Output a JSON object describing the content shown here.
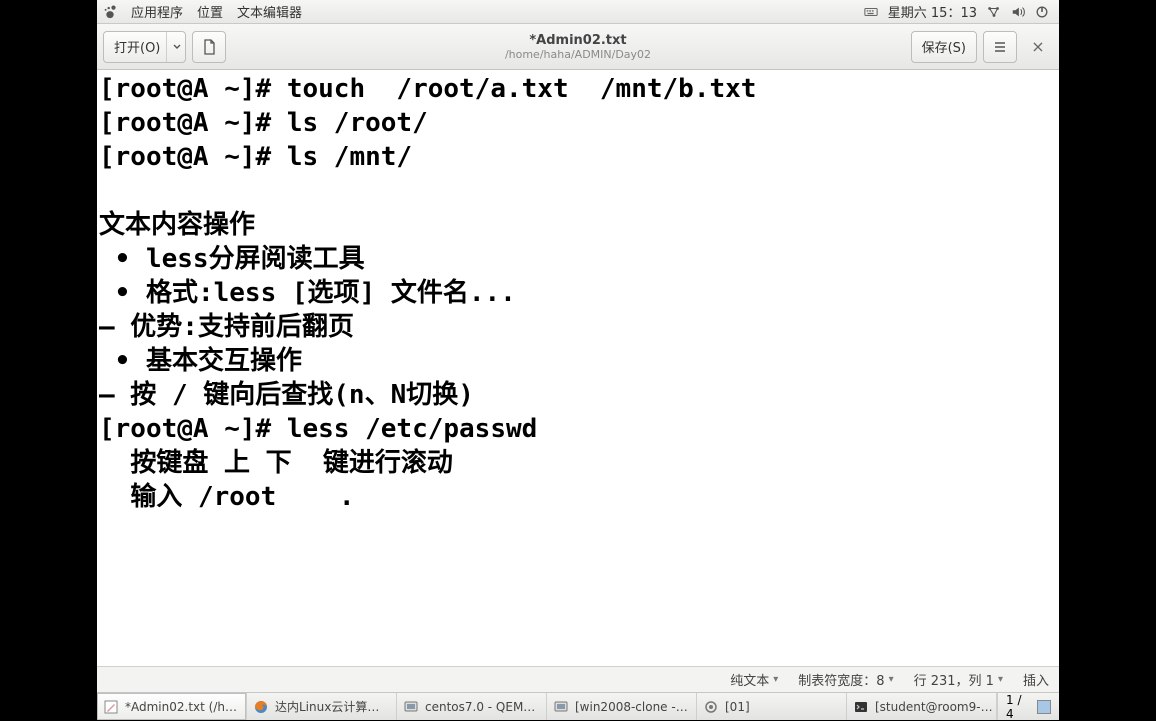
{
  "panel": {
    "menu_apps": "应用程序",
    "menu_places": "位置",
    "menu_editor": "文本编辑器",
    "clock": "星期六 15：13"
  },
  "editor": {
    "open_label": "打开(O)",
    "save_label": "保存(S)",
    "title": "*Admin02.txt",
    "subtitle": "/home/haha/ADMIN/Day02"
  },
  "document": {
    "lines": "[root@A ~]# touch  /root/a.txt  /mnt/b.txt\n[root@A ~]# ls /root/\n[root@A ~]# ls /mnt/\n\n文本内容操作\n • less分屏阅读工具\n • 格式:less [选项] 文件名...\n– 优势:支持前后翻页\n • 基本交互操作\n– 按 / 键向后查找(n、N切换)\n[root@A ~]# less /etc/passwd\n  按键盘 上 下  键进行滚动\n  输入 /root    ."
  },
  "status": {
    "syntax": "纯文本",
    "tabwidth": "制表符宽度：8",
    "position": "行 231，列 1",
    "mode": "插入"
  },
  "taskbar": {
    "items": [
      {
        "label": "*Admin02.txt (/h…",
        "icon": "editor"
      },
      {
        "label": "达内Linux云计算…",
        "icon": "firefox"
      },
      {
        "label": "centos7.0 - QEM…",
        "icon": "vm"
      },
      {
        "label": "[win2008-clone -…",
        "icon": "vm"
      },
      {
        "label": "[01]",
        "icon": "image"
      },
      {
        "label": "[student@room9-…",
        "icon": "terminal"
      }
    ],
    "pager": "1 / 4"
  }
}
